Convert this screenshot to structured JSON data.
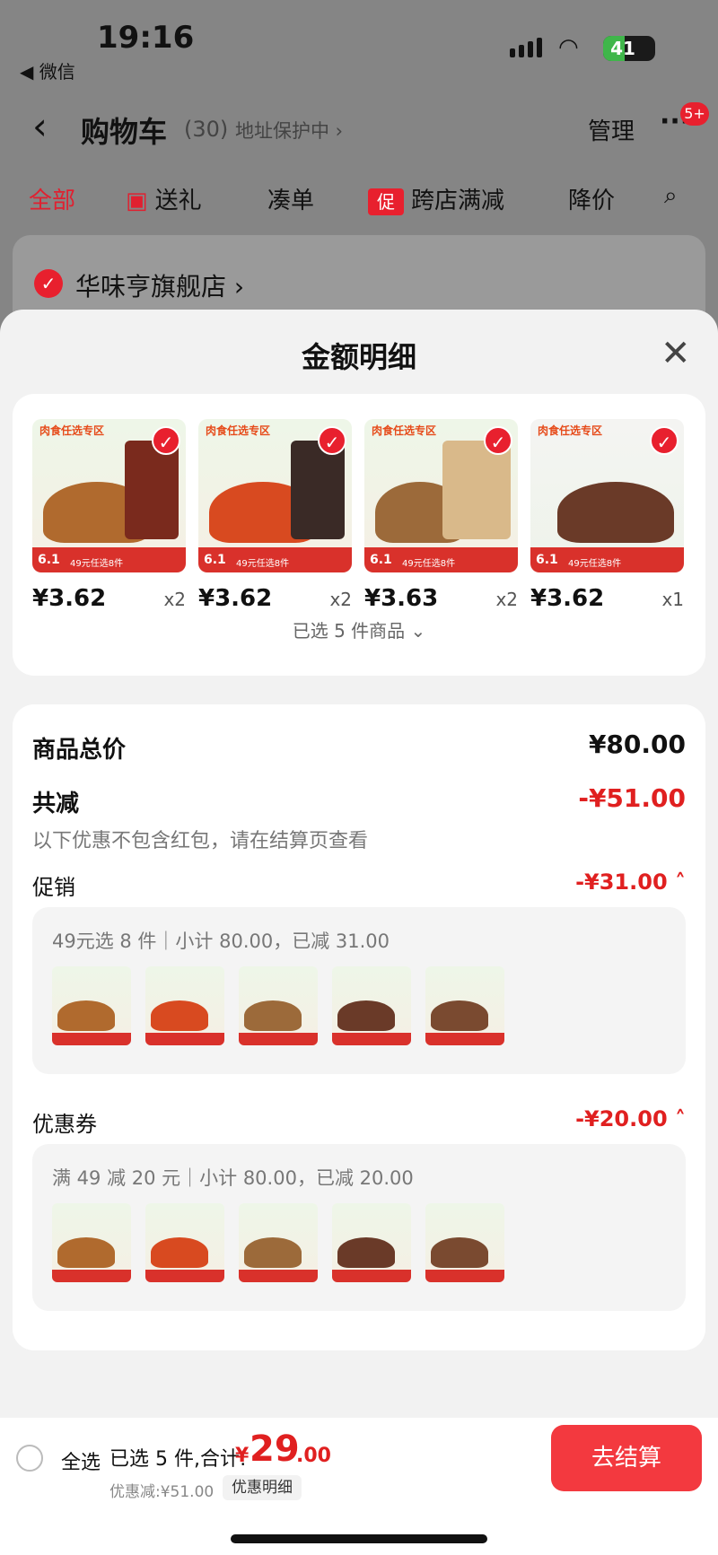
{
  "status": {
    "time": "19:16",
    "back_app": "◀ 微信",
    "battery": "41",
    "battery_level": 0.41
  },
  "nav": {
    "title": "购物车",
    "count": "(30)",
    "address": "地址保护中 ›",
    "manage": "管理",
    "more_badge": "5+"
  },
  "tabs": [
    {
      "label": "全部",
      "active": true
    },
    {
      "label": "送礼"
    },
    {
      "label": "凑单"
    },
    {
      "label": "跨店满减",
      "badge": "促"
    },
    {
      "label": "降价"
    }
  ],
  "store": {
    "name": "华味亨旗舰店 ›"
  },
  "sheet": {
    "title": "金额明细",
    "goods": [
      {
        "header": "肉食任选专区",
        "promo": "49元任选8件",
        "price": "¥3.62",
        "qty": "x2"
      },
      {
        "header": "肉食任选专区",
        "promo": "49元任选8件",
        "price": "¥3.62",
        "qty": "x2"
      },
      {
        "header": "肉食任选专区",
        "promo": "49元任选8件",
        "price": "¥3.63",
        "qty": "x2"
      },
      {
        "header": "肉食任选专区",
        "promo": "49元任选8件",
        "price": "¥3.62",
        "qty": "x1"
      }
    ],
    "selected_text": "已选 5 件商品 ⌄",
    "product_total_label": "商品总价",
    "product_total": "¥80.00",
    "reduce_label": "共减",
    "reduce_total": "-¥51.00",
    "reduce_note": "以下优惠不包含红包，请在结算页查看",
    "promotion": {
      "label": "促销",
      "value": "-¥31.00 ˄",
      "detail": "49元选 8 件｜小计 80.00，已减 31.00"
    },
    "coupon": {
      "label": "优惠券",
      "value": "-¥20.00 ˄",
      "detail": "满 49 减 20 元｜小计 80.00，已减 20.00"
    }
  },
  "bottom": {
    "select_all": "全选",
    "selected": "已选 5 件,合计:",
    "currency": "¥",
    "total_int": "29",
    "total_dec": ".00",
    "discount": "优惠减:¥51.00",
    "detail": "优惠明细",
    "checkout": "去结算"
  }
}
